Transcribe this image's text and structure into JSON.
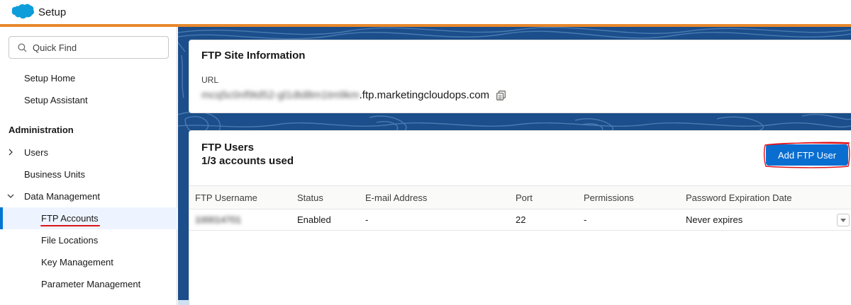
{
  "header": {
    "app_title": "Setup",
    "logo_icon": "salesforce-cloud-icon",
    "accent_color": "#e8882c"
  },
  "sidebar": {
    "search": {
      "placeholder": "Quick Find",
      "value": ""
    },
    "items": {
      "setup_home": "Setup Home",
      "setup_assistant": "Setup Assistant",
      "admin_heading": "Administration",
      "users": "Users",
      "business_units": "Business Units",
      "data_management": "Data Management",
      "ftp_accounts": "FTP Accounts",
      "file_locations": "File Locations",
      "key_management": "Key Management",
      "parameter_management": "Parameter Management"
    },
    "active_item": "FTP Accounts"
  },
  "site_info": {
    "title": "FTP Site Information",
    "url_label": "URL",
    "url_prefix_blurred": "mcq5c0nf9td52-gl1dtd8m1tm9km",
    "url_suffix": ".ftp.marketingcloudops.com"
  },
  "ftp_users": {
    "title": "FTP Users",
    "count_text": "1/3 accounts used",
    "add_button": "Add FTP User",
    "columns": [
      "FTP Username",
      "Status",
      "E-mail Address",
      "Port",
      "Permissions",
      "Password Expiration Date"
    ],
    "rows": [
      {
        "username_blurred": "100014701",
        "status": "Enabled",
        "email": "-",
        "port": "22",
        "permissions": "-",
        "expiration": "Never expires"
      }
    ]
  }
}
